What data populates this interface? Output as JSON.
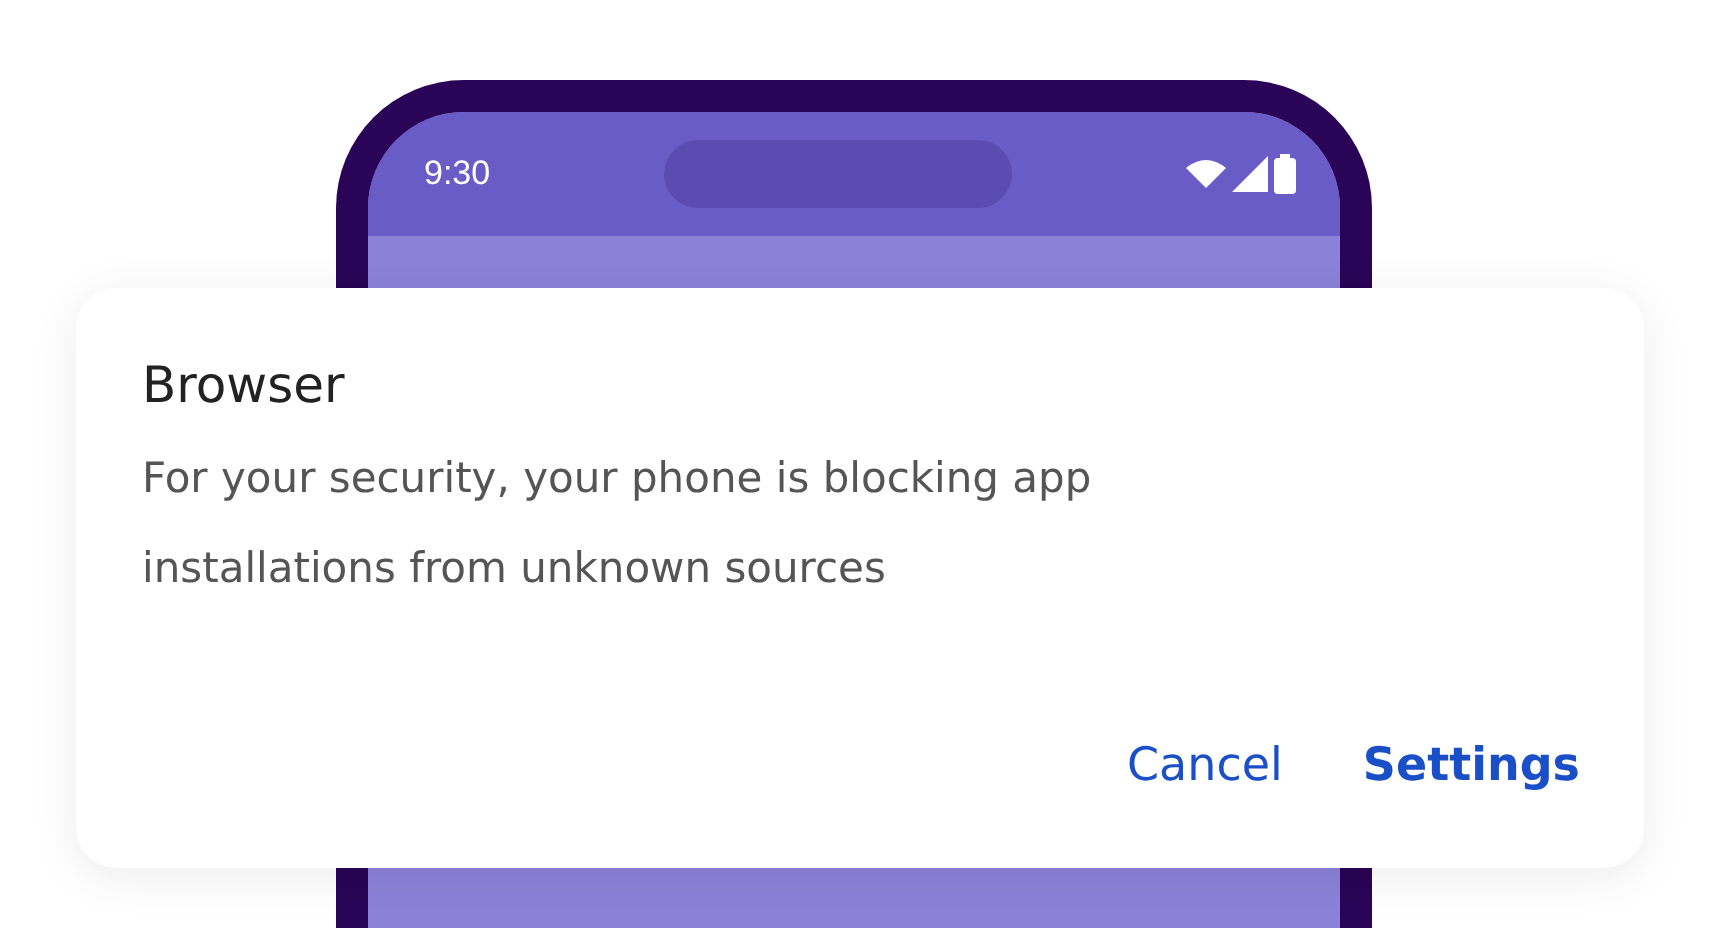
{
  "status_bar": {
    "time": "9:30"
  },
  "dialog": {
    "title": "Browser",
    "message": "For your security, your phone is blocking app installations from unknown sources",
    "buttons": [
      {
        "label": "Cancel",
        "kind": "plain"
      },
      {
        "label": "Settings",
        "kind": "primary"
      }
    ]
  }
}
